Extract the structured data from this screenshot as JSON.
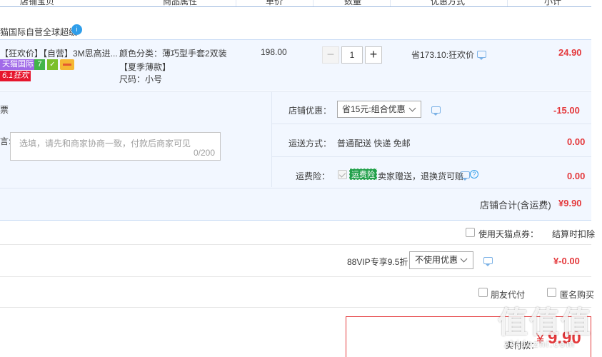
{
  "table_header": {
    "col_shop": "店铺宝贝",
    "col_attr": "商品属性",
    "col_price": "单价",
    "col_qty": "数量",
    "col_discount": "优惠方式",
    "col_subtotal": "小计"
  },
  "shop": {
    "name": "猫国际自营全球超级",
    "badge": "i"
  },
  "item": {
    "title": "【狂欢价】【自营】3M思高进...",
    "tags": {
      "tmall": "天猫国际",
      "seven": "7",
      "promo": "6.1狂欢"
    },
    "attr_line": "颜色分类：薄巧型手套2双装【夏季薄款】",
    "size_line": "尺码：小号",
    "unit_price": "198.00",
    "quantity": "1",
    "minus_label": "−",
    "plus_label": "+",
    "saving": "省173.10:狂欢价",
    "subtotal": "24.90"
  },
  "panel": {
    "invoice_label": "票",
    "message_label": "言:",
    "message_placeholder": "选填，请先和商家协商一致，付款后商家可见",
    "message_counter": "0/200",
    "coupon_label": "店铺优惠：",
    "coupon_value": "省15元:组合优惠",
    "coupon_amount": "-15.00",
    "shipping_label": "运送方式：",
    "shipping_value": "普通配送 快递 免邮",
    "shipping_amount": "0.00",
    "insurance_label": "运费险：",
    "insurance_tag": "运费险",
    "insurance_text": "卖家赠送，退换货可赔",
    "insurance_amount": "0.00",
    "shop_total_label": "店铺合计(含运费)",
    "shop_total_amount": "¥9.90"
  },
  "points": {
    "label": "使用天猫点券：",
    "note": "结算时扣除"
  },
  "vip": {
    "label": "88VIP专享9.5折",
    "select_value": "不使用优惠",
    "amount": "¥-0.00"
  },
  "options": {
    "friend_pay": "朋友代付",
    "anonymous": "匿名购买"
  },
  "payment": {
    "label": "实付款：",
    "yen": "¥",
    "value": "9.90"
  },
  "watermark": {
    "logo": "值值值",
    "site": "zhidezhi.com"
  },
  "colors": {
    "accent": "#e4393c",
    "panel_bg": "#f2f7ff",
    "tag_tmall": "#a16ae8",
    "tag_green": "#22a04b"
  }
}
